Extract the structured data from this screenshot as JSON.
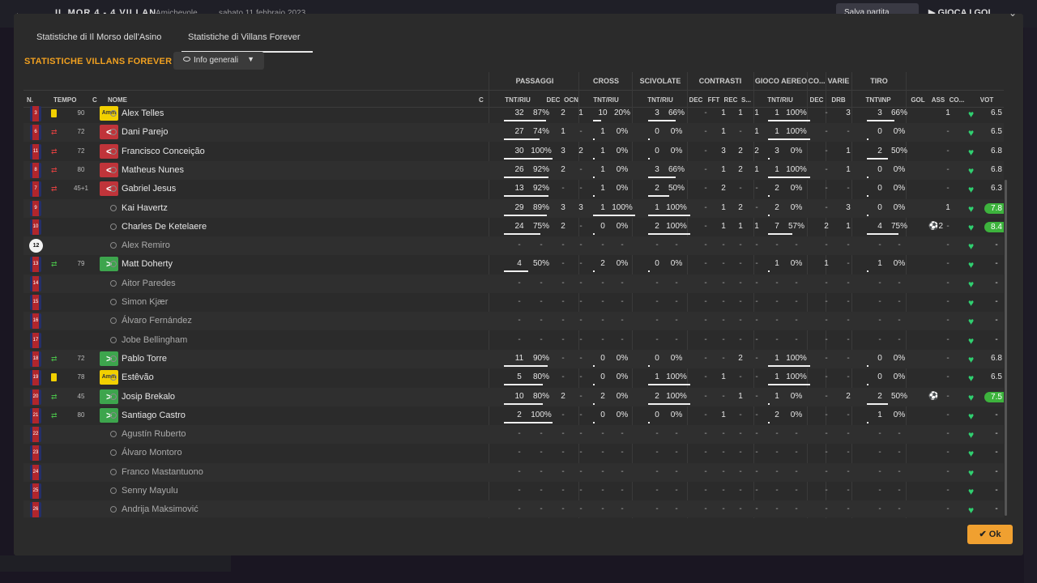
{
  "topbar": {
    "score": "IL MOR  4 - 4  VILLAN",
    "venue": "Amichevole",
    "date": "sabato 11 febbraio 2023",
    "save_label": "Salva partita",
    "play_label": "GIOCA I GOL"
  },
  "tabs": [
    "Statistiche di Il Morso dell'Asino",
    "Statistiche di Villans Forever"
  ],
  "section_title": "STATISTICHE VILLANS FOREVER",
  "dropdown_label": "Info generali",
  "groups": {
    "passaggi": "PASSAGGI",
    "cross": "CROSS",
    "scivolate": "SCIVOLATE",
    "contrasti": "CONTRASTI",
    "gioco_aereo": "GIOCO AEREO",
    "co": "CO...",
    "varie": "VARIE",
    "tiro": "TIRO"
  },
  "headers": {
    "n": "N.",
    "tempo": "TEMPO",
    "c": "C",
    "nome": "NOME",
    "c2": "C",
    "pass_tnt": "TNT/RIU",
    "pass_dec": "DEC",
    "pass_ocn": "OCN",
    "cross_tnt": "TNT/RIU",
    "sciv_tnt": "TNT/RIU",
    "con_dec": "DEC",
    "con_fft": "FFT",
    "con_rec": "REC",
    "con_s": "S...",
    "aereo_tnt": "TNT/RIU",
    "co_dec": "DEC",
    "varie_drb": "DRB",
    "tiro_tnt": "TNT\\INP",
    "gol": "GOL",
    "ass": "ASS",
    "co2": "CO...",
    "vot": "VOT"
  },
  "players": [
    {
      "num": "3",
      "card": "yellow",
      "min": "90",
      "act": "Amm",
      "name": "Alex Telles",
      "pt": "32",
      "pp": "87%",
      "pd": "2",
      "po": "1",
      "ct": "10",
      "cp": "20%",
      "st": "3",
      "sp": "66%",
      "cd": "-",
      "cf": "1",
      "cr": "1",
      "cs": "1",
      "at": "1",
      "ap": "100%",
      "od": "-",
      "dr": "3",
      "tt": "3",
      "tp": "66%",
      "gol": "",
      "ass": "1",
      "vot": "6.5",
      "hi": false,
      "ns": false
    },
    {
      "num": "6",
      "card": "out",
      "min": "72",
      "act": "<",
      "name": "Dani Parejo",
      "pt": "27",
      "pp": "74%",
      "pd": "1",
      "po": "-",
      "ct": "1",
      "cp": "0%",
      "st": "0",
      "sp": "0%",
      "cd": "-",
      "cf": "1",
      "cr": "-",
      "cs": "1",
      "at": "1",
      "ap": "100%",
      "od": "-",
      "dr": "-",
      "tt": "0",
      "tp": "0%",
      "gol": "",
      "ass": "-",
      "vot": "6.5",
      "hi": false,
      "ns": false
    },
    {
      "num": "11",
      "card": "out",
      "min": "72",
      "act": "<",
      "name": "Francisco Conceição",
      "pt": "30",
      "pp": "100%",
      "pd": "3",
      "po": "2",
      "ct": "1",
      "cp": "0%",
      "st": "0",
      "sp": "0%",
      "cd": "-",
      "cf": "3",
      "cr": "2",
      "cs": "2",
      "at": "3",
      "ap": "0%",
      "od": "-",
      "dr": "1",
      "tt": "2",
      "tp": "50%",
      "gol": "",
      "ass": "-",
      "vot": "6.8",
      "hi": false,
      "ns": false
    },
    {
      "num": "8",
      "card": "out",
      "min": "80",
      "act": "<",
      "name": "Matheus Nunes",
      "pt": "26",
      "pp": "92%",
      "pd": "2",
      "po": "-",
      "ct": "1",
      "cp": "0%",
      "st": "3",
      "sp": "66%",
      "cd": "-",
      "cf": "1",
      "cr": "2",
      "cs": "1",
      "at": "1",
      "ap": "100%",
      "od": "-",
      "dr": "1",
      "tt": "0",
      "tp": "0%",
      "gol": "",
      "ass": "-",
      "vot": "6.8",
      "hi": false,
      "ns": false
    },
    {
      "num": "7",
      "card": "out",
      "min": "45+1",
      "act": "<",
      "name": "Gabriel Jesus",
      "pt": "13",
      "pp": "92%",
      "pd": "-",
      "po": "-",
      "ct": "1",
      "cp": "0%",
      "st": "2",
      "sp": "50%",
      "cd": "-",
      "cf": "2",
      "cr": "-",
      "cs": "-",
      "at": "2",
      "ap": "0%",
      "od": "-",
      "dr": "-",
      "tt": "0",
      "tp": "0%",
      "gol": "",
      "ass": "-",
      "vot": "6.3",
      "hi": false,
      "ns": false
    },
    {
      "num": "9",
      "card": "",
      "min": "",
      "act": "",
      "name": "Kai Havertz",
      "pt": "29",
      "pp": "89%",
      "pd": "3",
      "po": "3",
      "ct": "1",
      "cp": "100%",
      "st": "1",
      "sp": "100%",
      "cd": "-",
      "cf": "1",
      "cr": "2",
      "cs": "-",
      "at": "2",
      "ap": "0%",
      "od": "-",
      "dr": "3",
      "tt": "0",
      "tp": "0%",
      "gol": "",
      "ass": "1",
      "vot": "7.8",
      "hi": true,
      "ns": false
    },
    {
      "num": "10",
      "card": "",
      "min": "",
      "act": "",
      "name": "Charles De Ketelaere",
      "pt": "24",
      "pp": "75%",
      "pd": "2",
      "po": "-",
      "ct": "0",
      "cp": "0%",
      "st": "2",
      "sp": "100%",
      "cd": "-",
      "cf": "1",
      "cr": "1",
      "cs": "1",
      "at": "7",
      "ap": "57%",
      "od": "2",
      "dr": "1",
      "tt": "4",
      "tp": "75%",
      "gol": "2",
      "ass": "-",
      "vot": "8.4",
      "hi": true,
      "ns": false
    },
    {
      "num": "12",
      "card": "gk",
      "min": "",
      "act": "",
      "name": "Alex Remiro",
      "pt": "-",
      "pp": "-",
      "pd": "-",
      "po": "-",
      "ct": "-",
      "cp": "-",
      "st": "-",
      "sp": "-",
      "cd": "-",
      "cf": "-",
      "cr": "-",
      "cs": "-",
      "at": "-",
      "ap": "-",
      "od": "-",
      "dr": "-",
      "tt": "-",
      "tp": "-",
      "gol": "",
      "ass": "-",
      "vot": "-",
      "hi": false,
      "ns": true
    },
    {
      "num": "13",
      "card": "in",
      "min": "79",
      "act": ">",
      "name": "Matt Doherty",
      "pt": "4",
      "pp": "50%",
      "pd": "-",
      "po": "-",
      "ct": "2",
      "cp": "0%",
      "st": "0",
      "sp": "0%",
      "cd": "-",
      "cf": "-",
      "cr": "-",
      "cs": "-",
      "at": "1",
      "ap": "0%",
      "od": "1",
      "dr": "-",
      "tt": "1",
      "tp": "0%",
      "gol": "",
      "ass": "-",
      "vot": "-",
      "hi": false,
      "ns": false
    },
    {
      "num": "14",
      "card": "",
      "min": "",
      "act": "",
      "name": "Aitor Paredes",
      "pt": "-",
      "pp": "-",
      "pd": "-",
      "po": "-",
      "ct": "-",
      "cp": "-",
      "st": "-",
      "sp": "-",
      "cd": "-",
      "cf": "-",
      "cr": "-",
      "cs": "-",
      "at": "-",
      "ap": "-",
      "od": "-",
      "dr": "-",
      "tt": "-",
      "tp": "-",
      "gol": "",
      "ass": "-",
      "vot": "-",
      "hi": false,
      "ns": true
    },
    {
      "num": "15",
      "card": "",
      "min": "",
      "act": "",
      "name": "Simon Kjær",
      "pt": "-",
      "pp": "-",
      "pd": "-",
      "po": "-",
      "ct": "-",
      "cp": "-",
      "st": "-",
      "sp": "-",
      "cd": "-",
      "cf": "-",
      "cr": "-",
      "cs": "-",
      "at": "-",
      "ap": "-",
      "od": "-",
      "dr": "-",
      "tt": "-",
      "tp": "-",
      "gol": "",
      "ass": "-",
      "vot": "-",
      "hi": false,
      "ns": true
    },
    {
      "num": "16",
      "card": "",
      "min": "",
      "act": "",
      "name": "Álvaro Fernández",
      "pt": "-",
      "pp": "-",
      "pd": "-",
      "po": "-",
      "ct": "-",
      "cp": "-",
      "st": "-",
      "sp": "-",
      "cd": "-",
      "cf": "-",
      "cr": "-",
      "cs": "-",
      "at": "-",
      "ap": "-",
      "od": "-",
      "dr": "-",
      "tt": "-",
      "tp": "-",
      "gol": "",
      "ass": "-",
      "vot": "-",
      "hi": false,
      "ns": true
    },
    {
      "num": "17",
      "card": "",
      "min": "",
      "act": "",
      "name": "Jobe Bellingham",
      "pt": "-",
      "pp": "-",
      "pd": "-",
      "po": "-",
      "ct": "-",
      "cp": "-",
      "st": "-",
      "sp": "-",
      "cd": "-",
      "cf": "-",
      "cr": "-",
      "cs": "-",
      "at": "-",
      "ap": "-",
      "od": "-",
      "dr": "-",
      "tt": "-",
      "tp": "-",
      "gol": "",
      "ass": "-",
      "vot": "-",
      "hi": false,
      "ns": true
    },
    {
      "num": "18",
      "card": "in",
      "min": "72",
      "act": ">",
      "name": "Pablo Torre",
      "pt": "11",
      "pp": "90%",
      "pd": "-",
      "po": "-",
      "ct": "0",
      "cp": "0%",
      "st": "0",
      "sp": "0%",
      "cd": "-",
      "cf": "-",
      "cr": "2",
      "cs": "-",
      "at": "1",
      "ap": "100%",
      "od": "-",
      "dr": "-",
      "tt": "0",
      "tp": "0%",
      "gol": "",
      "ass": "-",
      "vot": "6.8",
      "hi": false,
      "ns": false
    },
    {
      "num": "19",
      "card": "yellow",
      "min": "78",
      "act": "Amm",
      "name": "Estêvão",
      "pt": "5",
      "pp": "80%",
      "pd": "-",
      "po": "-",
      "ct": "0",
      "cp": "0%",
      "st": "1",
      "sp": "100%",
      "cd": "-",
      "cf": "1",
      "cr": "-",
      "cs": "-",
      "at": "1",
      "ap": "100%",
      "od": "-",
      "dr": "-",
      "tt": "0",
      "tp": "0%",
      "gol": "",
      "ass": "-",
      "vot": "6.5",
      "hi": false,
      "ns": false
    },
    {
      "num": "20",
      "card": "in",
      "min": "45",
      "act": ">",
      "name": "Josip Brekalo",
      "pt": "10",
      "pp": "80%",
      "pd": "2",
      "po": "-",
      "ct": "2",
      "cp": "0%",
      "st": "2",
      "sp": "100%",
      "cd": "-",
      "cf": "-",
      "cr": "1",
      "cs": "-",
      "at": "1",
      "ap": "0%",
      "od": "-",
      "dr": "2",
      "tt": "2",
      "tp": "50%",
      "gol": "1",
      "ass": "-",
      "vot": "7.5",
      "hi": true,
      "ns": false
    },
    {
      "num": "21",
      "card": "in",
      "min": "80",
      "act": ">",
      "name": "Santiago Castro",
      "pt": "2",
      "pp": "100%",
      "pd": "-",
      "po": "-",
      "ct": "0",
      "cp": "0%",
      "st": "0",
      "sp": "0%",
      "cd": "-",
      "cf": "1",
      "cr": "-",
      "cs": "-",
      "at": "2",
      "ap": "0%",
      "od": "-",
      "dr": "-",
      "tt": "1",
      "tp": "0%",
      "gol": "",
      "ass": "-",
      "vot": "-",
      "hi": false,
      "ns": false
    },
    {
      "num": "22",
      "card": "",
      "min": "",
      "act": "",
      "name": "Agustín Ruberto",
      "pt": "-",
      "pp": "-",
      "pd": "-",
      "po": "-",
      "ct": "-",
      "cp": "-",
      "st": "-",
      "sp": "-",
      "cd": "-",
      "cf": "-",
      "cr": "-",
      "cs": "-",
      "at": "-",
      "ap": "-",
      "od": "-",
      "dr": "-",
      "tt": "-",
      "tp": "-",
      "gol": "",
      "ass": "-",
      "vot": "-",
      "hi": false,
      "ns": true
    },
    {
      "num": "23",
      "card": "",
      "min": "",
      "act": "",
      "name": "Álvaro Montoro",
      "pt": "-",
      "pp": "-",
      "pd": "-",
      "po": "-",
      "ct": "-",
      "cp": "-",
      "st": "-",
      "sp": "-",
      "cd": "-",
      "cf": "-",
      "cr": "-",
      "cs": "-",
      "at": "-",
      "ap": "-",
      "od": "-",
      "dr": "-",
      "tt": "-",
      "tp": "-",
      "gol": "",
      "ass": "-",
      "vot": "-",
      "hi": false,
      "ns": true
    },
    {
      "num": "24",
      "card": "",
      "min": "",
      "act": "",
      "name": "Franco Mastantuono",
      "pt": "-",
      "pp": "-",
      "pd": "-",
      "po": "-",
      "ct": "-",
      "cp": "-",
      "st": "-",
      "sp": "-",
      "cd": "-",
      "cf": "-",
      "cr": "-",
      "cs": "-",
      "at": "-",
      "ap": "-",
      "od": "-",
      "dr": "-",
      "tt": "-",
      "tp": "-",
      "gol": "",
      "ass": "-",
      "vot": "-",
      "hi": false,
      "ns": true
    },
    {
      "num": "25",
      "card": "",
      "min": "",
      "act": "",
      "name": "Senny Mayulu",
      "pt": "-",
      "pp": "-",
      "pd": "-",
      "po": "-",
      "ct": "-",
      "cp": "-",
      "st": "-",
      "sp": "-",
      "cd": "-",
      "cf": "-",
      "cr": "-",
      "cs": "-",
      "at": "-",
      "ap": "-",
      "od": "-",
      "dr": "-",
      "tt": "-",
      "tp": "-",
      "gol": "",
      "ass": "-",
      "vot": "-",
      "hi": false,
      "ns": true
    },
    {
      "num": "26",
      "card": "",
      "min": "",
      "act": "",
      "name": "Andrija Maksimović",
      "pt": "-",
      "pp": "-",
      "pd": "-",
      "po": "-",
      "ct": "-",
      "cp": "-",
      "st": "-",
      "sp": "-",
      "cd": "-",
      "cf": "-",
      "cr": "-",
      "cs": "-",
      "at": "-",
      "ap": "-",
      "od": "-",
      "dr": "-",
      "tt": "-",
      "tp": "-",
      "gol": "",
      "ass": "-",
      "vot": "-",
      "hi": false,
      "ns": true
    }
  ],
  "ok_label": "Ok",
  "colors": {
    "accent": "#f0a020",
    "sub_out": "#c0343a",
    "sub_in": "#3da54d",
    "yellow_card": "#f2d000",
    "rating_high": "#3db33d"
  }
}
